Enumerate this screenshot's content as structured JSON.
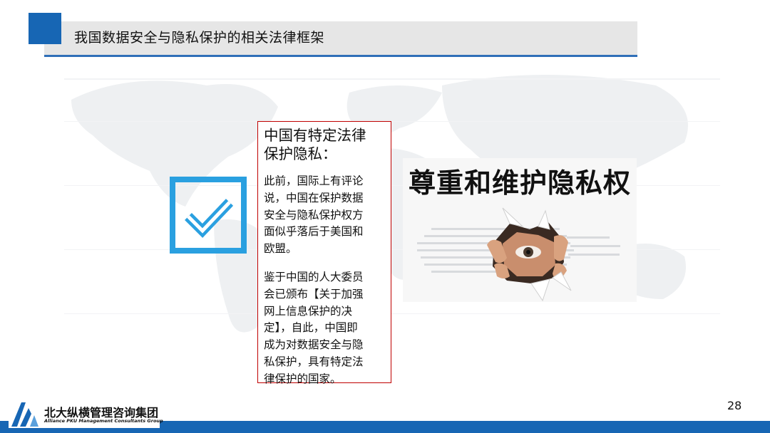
{
  "header": {
    "title": "我国数据安全与隐私保护的相关法律框架"
  },
  "panel": {
    "heading_line1": "中国有特定法律",
    "heading_line2": "保护隐私：",
    "para1_lines": [
      "此前，国际上有评论",
      "说，中国在保护数据",
      "安全与隐私保护权方",
      "面似乎落后于美国和",
      "欧盟。"
    ],
    "para2_lines": [
      "鉴于中国的人大委员",
      "会已颁布【关于加强",
      "网上信息保护的决",
      "定】，自此，中国即",
      "成为对数据安全与隐",
      "私保护，具有特定法",
      "律保护的国家。"
    ]
  },
  "image": {
    "caption": "尊重和维护隐私权"
  },
  "footer": {
    "logo_cn": "北大纵横管理咨询集团",
    "logo_en": "Alliance PKU Management Consultants Group",
    "page_number": "28"
  },
  "colors": {
    "brand_blue": "#1766b4",
    "check_blue": "#2aa0e0",
    "panel_border": "#c00000",
    "title_bar_gray": "#e6e6e6"
  },
  "icons": {
    "checkmark": "checkmark-icon",
    "logo": "pku-logo-icon"
  }
}
